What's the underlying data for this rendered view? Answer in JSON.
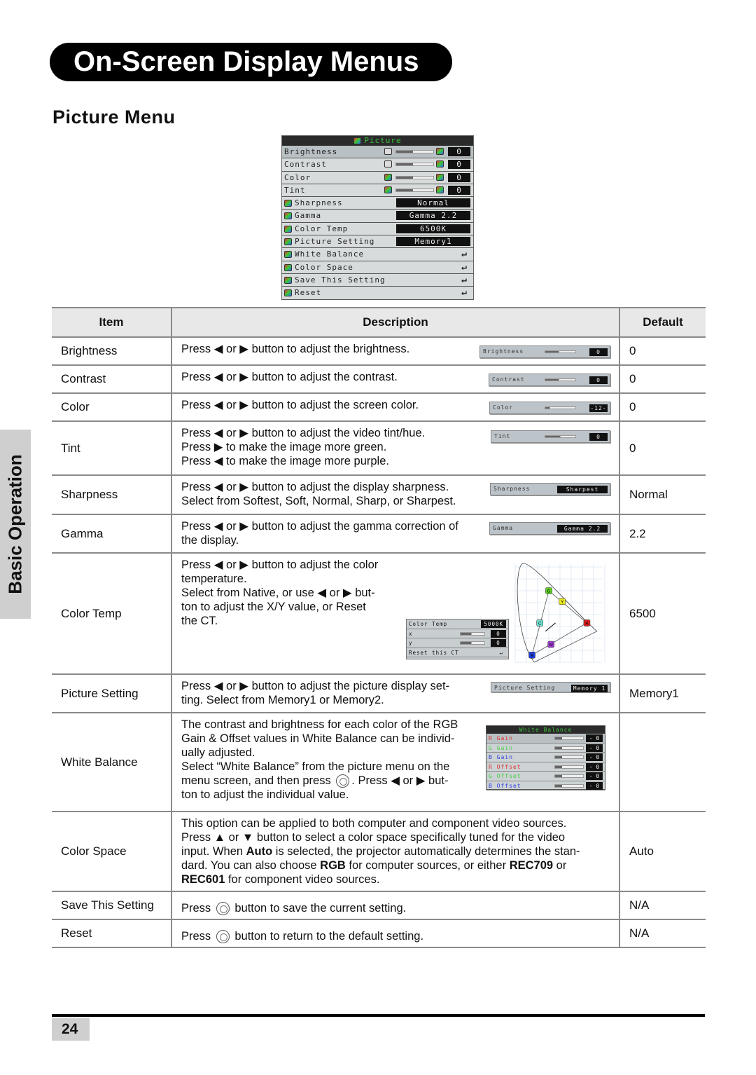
{
  "header": {
    "title": "On-Screen Display Menus",
    "section": "Picture Menu",
    "side_tab": "Basic Operation",
    "page_number": "24"
  },
  "colors": {
    "osd_title_text": "#3cc43c",
    "osd_bg": "#d7dbdb",
    "table_border": "#8a8a8a",
    "header_bg": "#e8e8e8"
  },
  "osd": {
    "title": "Picture",
    "items": [
      {
        "label": "Brightness",
        "value": "0",
        "type": "slider",
        "level": 0.45,
        "selected": true
      },
      {
        "label": "Contrast",
        "value": "0",
        "type": "slider",
        "level": 0.45
      },
      {
        "label": "Color",
        "value": "0",
        "type": "slider",
        "level": 0.45
      },
      {
        "label": "Tint",
        "value": "0",
        "type": "slider",
        "level": 0.45
      },
      {
        "label": "Sharpness",
        "value": "Normal",
        "type": "option",
        "icon": "sharpness-icon"
      },
      {
        "label": "Gamma",
        "value": "Gamma 2.2",
        "type": "option",
        "icon": "gamma-icon"
      },
      {
        "label": "Color Temp",
        "value": "6500K",
        "type": "option",
        "icon": "thermometer-icon"
      },
      {
        "label": "Picture Setting",
        "value": "Memory1",
        "type": "option",
        "icon": "document-icon"
      },
      {
        "label": "White Balance",
        "type": "enter",
        "icon": "white-balance-icon"
      },
      {
        "label": "Color Space",
        "type": "enter",
        "icon": "color-space-icon"
      },
      {
        "label": "Save This Setting",
        "type": "enter",
        "icon": "floppy-icon"
      },
      {
        "label": "Reset",
        "type": "enter",
        "icon": "folder-icon"
      }
    ],
    "enter_glyph": "↵"
  },
  "table": {
    "headers": [
      "Item",
      "Description",
      "Default"
    ],
    "rows": [
      {
        "item": "Brightness",
        "default": "0",
        "desc": [
          [
            "Press ◀ or ▶ button to adjust the brightness."
          ]
        ],
        "mini": {
          "label": "Brightness",
          "value": "0",
          "type": "slider",
          "level": 0.45
        }
      },
      {
        "item": "Contrast",
        "default": "0",
        "desc": [
          [
            "Press ◀ or ▶ button to adjust the contrast."
          ]
        ],
        "mini": {
          "label": "Contrast",
          "value": "0",
          "type": "slider",
          "level": 0.45
        }
      },
      {
        "item": "Color",
        "default": "0",
        "desc": [
          [
            "Press ◀ or ▶ button to adjust the screen color."
          ]
        ],
        "mini": {
          "label": "Color",
          "value": "-12-",
          "type": "slider",
          "level": 0.15
        }
      },
      {
        "item": "Tint",
        "default": "0",
        "desc": [
          [
            "Press ◀ or ▶ button to adjust the video tint/hue."
          ],
          [
            "Press ▶ to make the image more green."
          ],
          [
            "Press ◀ to make the image more purple."
          ]
        ],
        "mini": {
          "label": "Tint",
          "value": "0",
          "type": "slider",
          "level": 0.5
        }
      },
      {
        "item": "Sharpness",
        "default": "Normal",
        "desc": [
          [
            "Press ◀ or ▶ button to adjust the display sharpness."
          ],
          [
            "Select from Softest, Soft, Normal, Sharp, or Sharpest."
          ]
        ],
        "mini": {
          "label": "Sharpness",
          "value": "Sharpest",
          "type": "option"
        }
      },
      {
        "item": "Gamma",
        "default": "2.2",
        "desc": [
          [
            "Press ◀ or ▶ button to adjust the gamma correction of"
          ],
          [
            "the display."
          ]
        ],
        "mini": {
          "label": "Gamma",
          "value": "Gamma 2.2",
          "type": "option"
        }
      },
      {
        "item": "Color Temp",
        "default": "6500",
        "desc": [
          [
            "Press ◀ or ▶ button to adjust the color"
          ],
          [
            "temperature."
          ],
          [
            "Select from Native, or use ◀ or ▶ but-"
          ],
          [
            "ton to adjust the X/Y value, or Reset"
          ],
          [
            "the CT."
          ]
        ],
        "ct_panel": {
          "rows": [
            {
              "label": "Color Temp",
              "value": "5000K"
            },
            {
              "label": "x",
              "value": "0",
              "level": 0.45
            },
            {
              "label": "y",
              "value": "0",
              "level": 0.45
            },
            {
              "label": "Reset this CT",
              "value": "↵"
            }
          ]
        },
        "cie_chart": {
          "points": [
            {
              "label": "R",
              "color": "#e02020",
              "x": 0.64,
              "y": 0.33
            },
            {
              "label": "G",
              "color": "#60d020",
              "x": 0.3,
              "y": 0.6
            },
            {
              "label": "B",
              "color": "#2040e0",
              "x": 0.15,
              "y": 0.06
            },
            {
              "label": "C",
              "color": "#70e0d0",
              "x": 0.22,
              "y": 0.33
            },
            {
              "label": "M",
              "color": "#a040d0",
              "x": 0.32,
              "y": 0.15
            },
            {
              "label": "Y",
              "color": "#e8e820",
              "x": 0.42,
              "y": 0.51
            }
          ]
        }
      },
      {
        "item": "Picture Setting",
        "default": "Memory1",
        "desc": [
          [
            "Press ◀ or ▶ button to adjust the picture display set-"
          ],
          [
            "ting. Select from Memory1 or Memory2."
          ]
        ],
        "mini": {
          "label": "Picture Setting",
          "value": "Memory 1",
          "type": "option"
        }
      },
      {
        "item": "White Balance",
        "default": "",
        "desc": [
          [
            "The contrast and brightness for each color of the RGB"
          ],
          [
            "Gain & Offset values in White Balance can be individ-"
          ],
          [
            "ually adjusted."
          ],
          [
            "Select “White Balance” from the picture menu on the"
          ],
          [
            "menu screen, and then press ",
            {
              "icon": "enter-button-icon"
            },
            ". Press ◀ or ▶ but-"
          ],
          [
            "ton to adjust the individual value."
          ]
        ],
        "wb_panel": {
          "title": "White Balance",
          "rows": [
            {
              "label": "R Gain",
              "color": "#e03030",
              "value": "- 0 -"
            },
            {
              "label": "G Gain",
              "color": "#40d040",
              "value": "- 0 -"
            },
            {
              "label": "B Gain",
              "color": "#3040e0",
              "value": "- 0 -"
            },
            {
              "label": "R Offset",
              "color": "#e03030",
              "value": "- 0 -"
            },
            {
              "label": "G Offset",
              "color": "#40d040",
              "value": "- 0 -"
            },
            {
              "label": "B Offset",
              "color": "#3040e0",
              "value": "- 0 -"
            }
          ]
        }
      },
      {
        "item": "Color Space",
        "default": "Auto",
        "desc": [
          [
            "This option can be applied to both computer and component video sources."
          ],
          [
            "Press ▲ or ▼ button to select a color space specifically tuned for the video"
          ],
          [
            "input. When ",
            {
              "b": "Auto"
            },
            " is selected, the projector automatically determines the stan-"
          ],
          [
            "dard. You can also choose ",
            {
              "b": "RGB"
            },
            " for computer sources, or either ",
            {
              "b": "REC709"
            },
            " or"
          ],
          [
            {
              "b": "REC601"
            },
            " for component video sources."
          ]
        ]
      },
      {
        "item": "Save This Setting",
        "default": "N/A",
        "desc": [
          [
            "Press ",
            {
              "icon": "enter-button-icon"
            },
            " button to save the current setting."
          ]
        ]
      },
      {
        "item": "Reset",
        "default": "N/A",
        "desc": [
          [
            "Press ",
            {
              "icon": "enter-button-icon"
            },
            " button to return to the default setting."
          ]
        ]
      }
    ]
  }
}
